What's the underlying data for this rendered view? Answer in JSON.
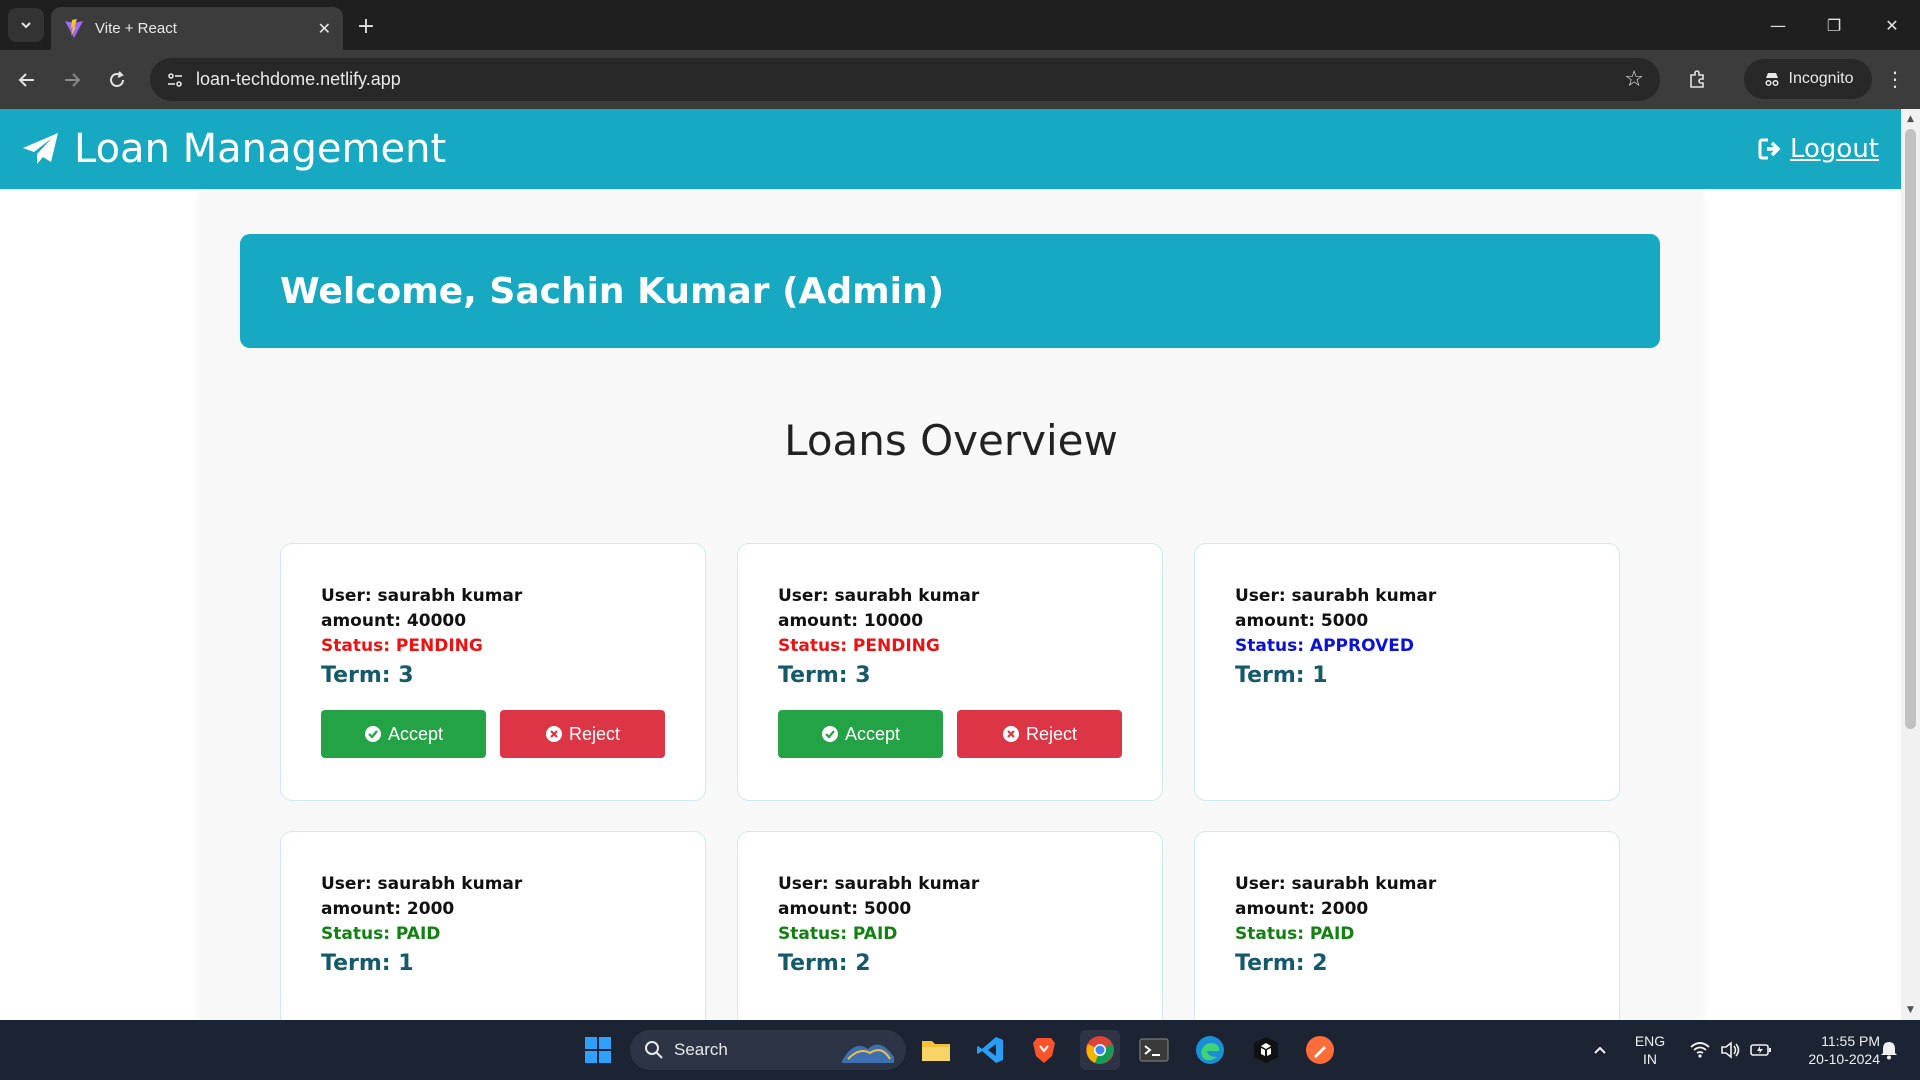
{
  "browser": {
    "tab_title": "Vite + React",
    "url": "loan-techdome.netlify.app",
    "incognito_label": "Incognito"
  },
  "header": {
    "brand": "Loan Management",
    "logout_label": "Logout",
    "color": "#17a9c2"
  },
  "welcome": {
    "text": "Welcome, Sachin Kumar (Admin)"
  },
  "section_title": "Loans Overview",
  "actions": {
    "accept_label": "Accept",
    "reject_label": "Reject"
  },
  "loans": [
    {
      "user": "User: saurabh kumar",
      "amount": "amount: 40000",
      "status": "Status: PENDING",
      "term": "Term: 3"
    },
    {
      "user": "User: saurabh kumar",
      "amount": "amount: 10000",
      "status": "Status: PENDING",
      "term": "Term: 3"
    },
    {
      "user": "User: saurabh kumar",
      "amount": "amount: 5000",
      "status": "Status: APPROVED",
      "term": "Term: 1"
    },
    {
      "user": "User: saurabh kumar",
      "amount": "amount: 2000",
      "status": "Status: PAID",
      "term": "Term: 1"
    },
    {
      "user": "User: saurabh kumar",
      "amount": "amount: 5000",
      "status": "Status: PAID",
      "term": "Term: 2"
    },
    {
      "user": "User: saurabh kumar",
      "amount": "amount: 2000",
      "status": "Status: PAID",
      "term": "Term: 2"
    }
  ],
  "status_colors": {
    "pending": "#ee1111",
    "approved": "#0a12d8",
    "paid": "#138012"
  },
  "taskbar": {
    "search_label": "Search",
    "lang_line1": "ENG",
    "lang_line2": "IN",
    "time": "11:55 PM",
    "date": "20-10-2024",
    "apps": [
      "windows-start-icon",
      "file-explorer-icon",
      "vscode-icon",
      "brave-icon",
      "chrome-icon",
      "terminal-icon",
      "edge-icon",
      "app-icon",
      "postman-icon"
    ]
  }
}
